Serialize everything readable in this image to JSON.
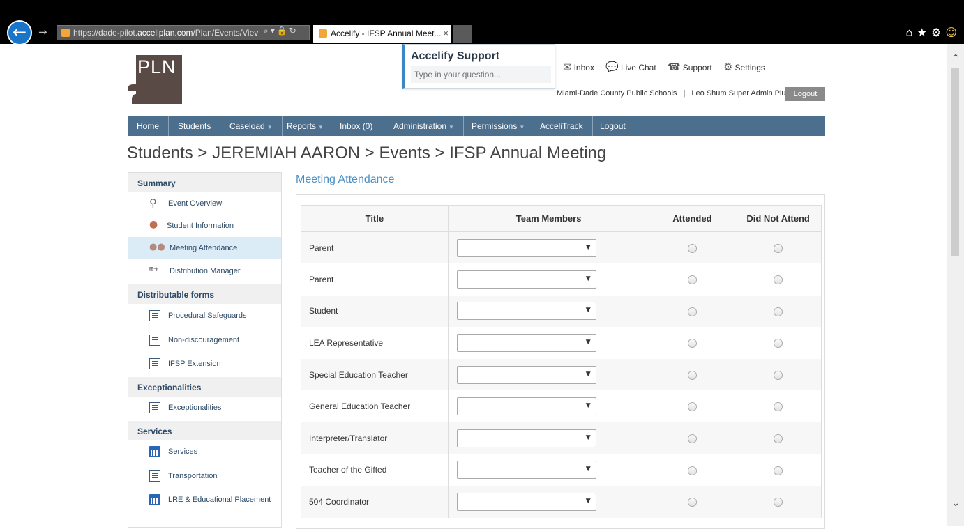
{
  "browser": {
    "url_prefix": "https://dade-pilot.",
    "url_host": "acceliplan.com",
    "url_path": "/Plan/Events/Viev",
    "tab_title": "Accelify - IFSP Annual Meet...",
    "tab_close": "×"
  },
  "logo": {
    "text": "PLN"
  },
  "support": {
    "title": "Accelify Support",
    "placeholder": "Type in your question..."
  },
  "top_links": {
    "inbox": "Inbox",
    "live_chat": "Live Chat",
    "support": "Support",
    "settings": "Settings"
  },
  "user": {
    "district": "Miami-Dade County Public Schools",
    "separator": "|",
    "name": "Leo Shum Super Admin Plus",
    "logout": "Logout"
  },
  "nav": [
    {
      "label": "Home"
    },
    {
      "label": "Students"
    },
    {
      "label": "Caseload"
    },
    {
      "label": "Reports"
    },
    {
      "label": "Inbox (0)"
    },
    {
      "label": "Administration"
    },
    {
      "label": "Permissions"
    },
    {
      "label": "AcceliTrack"
    },
    {
      "label": "Logout"
    }
  ],
  "breadcrumb": "Students > JEREMIAH AARON > Events > IFSP Annual Meeting",
  "sidebar": {
    "summary": "Summary",
    "event_overview": "Event Overview",
    "student_information": "Student Information",
    "meeting_attendance": "Meeting Attendance",
    "distribution_manager": "Distribution Manager",
    "distributable_forms": "Distributable forms",
    "procedural_safeguards": "Procedural Safeguards",
    "non_discouragement": "Non-discouragement",
    "ifsp_extension": "IFSP Extension",
    "exceptionalities_head": "Exceptionalities",
    "exceptionalities": "Exceptionalities",
    "services_head": "Services",
    "services": "Services",
    "transportation": "Transportation",
    "lre": "LRE & Educational Placement"
  },
  "main": {
    "section_title": "Meeting Attendance",
    "columns": [
      "Title",
      "Team Members",
      "Attended",
      "Did Not Attend"
    ],
    "rows": [
      {
        "title": "Parent",
        "member": ""
      },
      {
        "title": "Parent",
        "member": ""
      },
      {
        "title": "Student",
        "member": ""
      },
      {
        "title": "LEA Representative",
        "member": ""
      },
      {
        "title": "Special Education Teacher",
        "member": ""
      },
      {
        "title": "General Education Teacher",
        "member": ""
      },
      {
        "title": "Interpreter/Translator",
        "member": ""
      },
      {
        "title": "Teacher of the Gifted",
        "member": ""
      },
      {
        "title": "504 Coordinator",
        "member": ""
      }
    ]
  },
  "colors": {
    "nav_bg": "#4d6f8e",
    "accent_blue": "#4a8ec2",
    "active_sidebar": "#dbecf7"
  }
}
